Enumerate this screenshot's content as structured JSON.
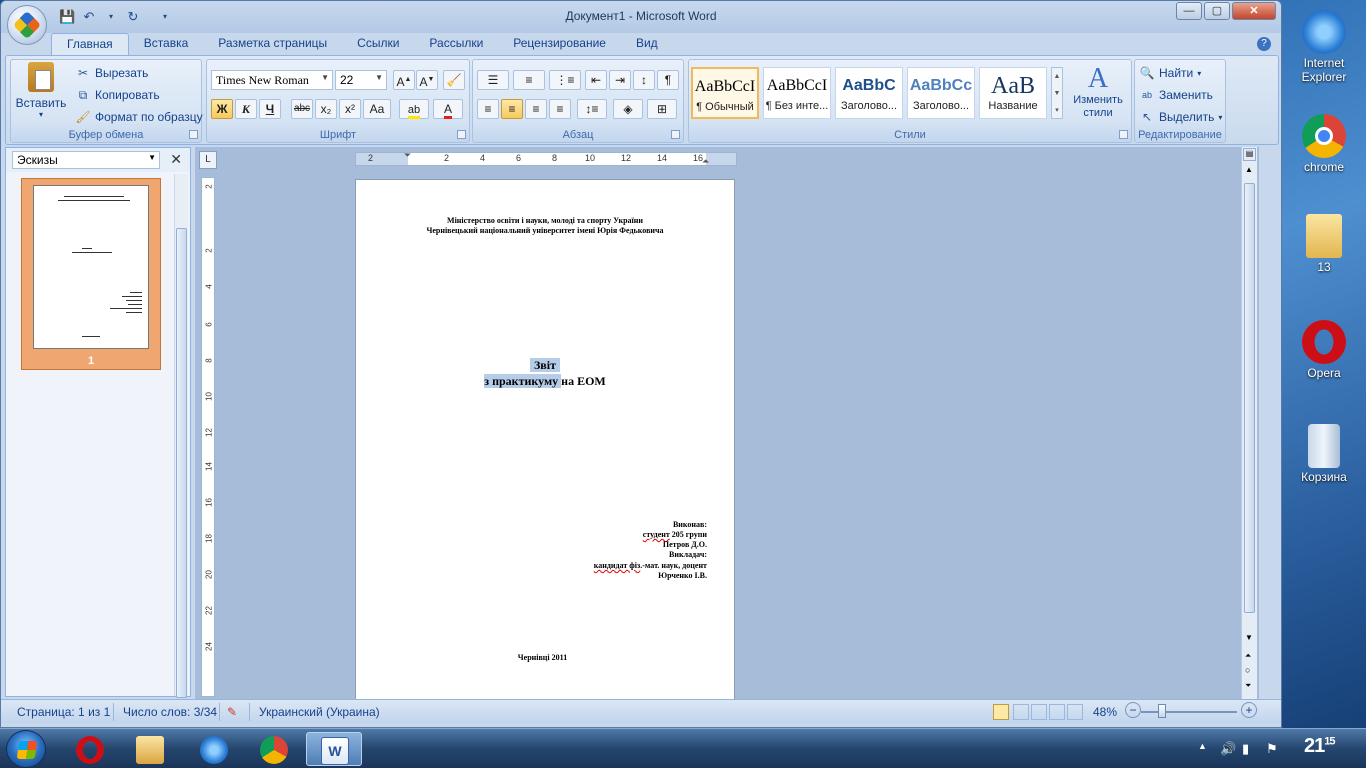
{
  "window": {
    "title": "Документ1 - Microsoft Word",
    "controls": {
      "minimize": "—",
      "maximize": "▢",
      "close": "✕"
    }
  },
  "tabs": [
    "Главная",
    "Вставка",
    "Разметка страницы",
    "Ссылки",
    "Рассылки",
    "Рецензирование",
    "Вид"
  ],
  "ribbon": {
    "clipboard": {
      "label": "Буфер обмена",
      "paste": "Вставить",
      "cut": "Вырезать",
      "copy": "Копировать",
      "format_painter": "Формат по образцу"
    },
    "font": {
      "label": "Шрифт",
      "font_name": "Times New Roman",
      "font_size": "22",
      "bold": "Ж",
      "italic": "К",
      "underline": "Ч",
      "strikethrough": "abc",
      "subscript": "x₂",
      "superscript": "x²",
      "change_case": "Aa"
    },
    "paragraph": {
      "label": "Абзац"
    },
    "styles": {
      "label": "Стили",
      "items": [
        {
          "sample": "AaBbCcI",
          "name": "¶ Обычный"
        },
        {
          "sample": "AaBbCcI",
          "name": "¶ Без инте..."
        },
        {
          "sample": "AaBbC",
          "name": "Заголово..."
        },
        {
          "sample": "AaBbCc",
          "name": "Заголово..."
        },
        {
          "sample": "AaB",
          "name": "Название"
        }
      ],
      "change_styles": "Изменить стили"
    },
    "editing": {
      "label": "Редактирование",
      "find": "Найти",
      "replace": "Заменить",
      "select": "Выделить"
    }
  },
  "pane": {
    "title": "Эскизы",
    "thumb_number": "1"
  },
  "ruler": {
    "h": [
      "2",
      "2",
      "4",
      "6",
      "8",
      "10",
      "12",
      "14",
      "16"
    ],
    "v": [
      "2",
      "2",
      "4",
      "6",
      "8",
      "10",
      "12",
      "14",
      "16",
      "18",
      "20",
      "22",
      "24"
    ]
  },
  "document": {
    "header_line1": "Міністерство освіти і науки, молоді та спорту України",
    "header_line2": "Чернівецький національний університет імені Юрія Федьковича",
    "title1": "Звіт",
    "title2_selected": "з практикуму ",
    "title2_rest": "на ЕОМ",
    "performed": "Виконав:",
    "student_word": "студент",
    "student_rest": " 205 групи",
    "student_name": "Петров Д.О.",
    "teacher": "Викладач:",
    "degree_word": "кандидат фіз",
    "degree_rest": ".-мат. наук, доцент",
    "teacher_name": "Юрченко І.В.",
    "footer": "Чернівці 2011"
  },
  "status": {
    "page": "Страница: 1 из 1",
    "words": "Число слов: 3/34",
    "language": "Украинский (Украина)",
    "zoom": "48%",
    "zoom_out": "−",
    "zoom_in": "+"
  },
  "desktop": {
    "icons": [
      {
        "label": "Internet Explorer",
        "color": "#2c7ed6"
      },
      {
        "label": "chrome",
        "color": "#db4437"
      },
      {
        "label": "13",
        "color": "#e9c46a"
      },
      {
        "label": "Opera",
        "color": "#cc0f16"
      },
      {
        "label": "Корзина",
        "color": "#9fb8d4"
      }
    ]
  },
  "taskbar": {
    "clock_hours": "21",
    "clock_minutes": "15"
  }
}
